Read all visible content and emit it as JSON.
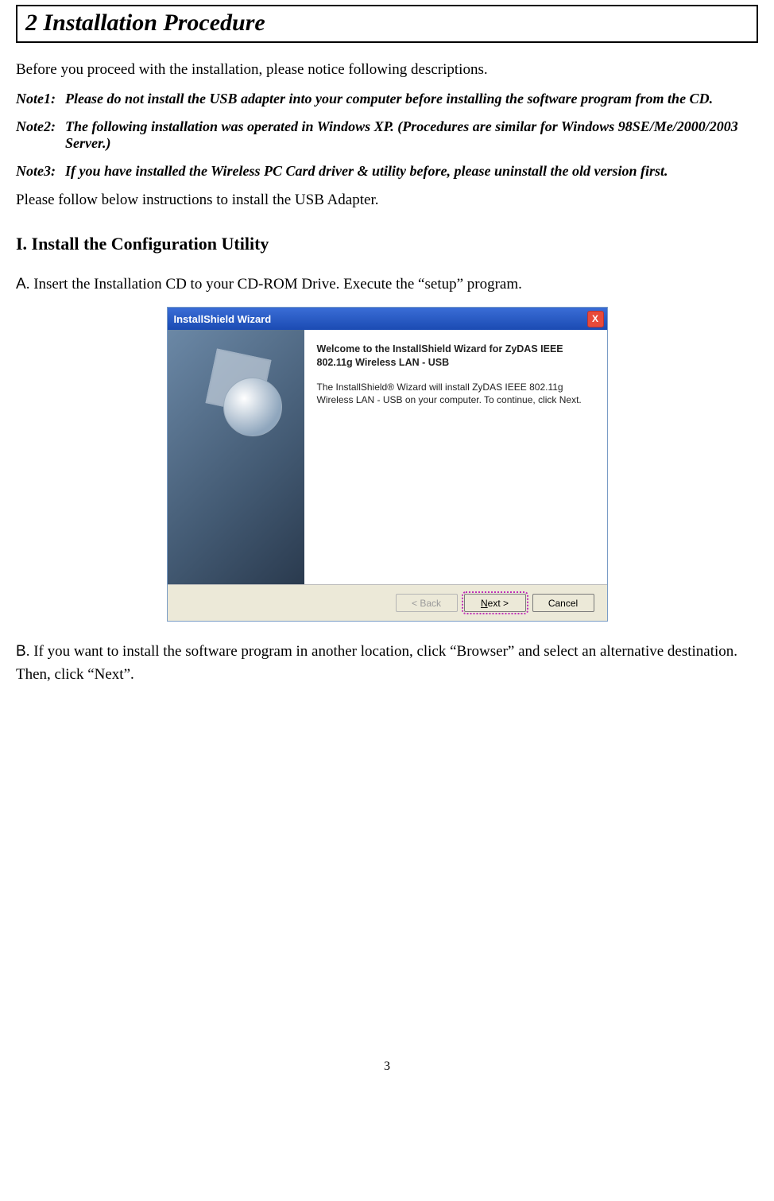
{
  "chapter": {
    "title": "2  Installation Procedure"
  },
  "intro": "Before you proceed with the installation, please notice following descriptions.",
  "notes": [
    {
      "label": "Note1:",
      "body": "Please do not install the USB adapter into your computer before installing the software program from the CD."
    },
    {
      "label": "Note2:",
      "body": "The following installation was operated in Windows XP.  (Procedures are similar for Windows 98SE/Me/2000/2003 Server.)"
    },
    {
      "label": "Note3:",
      "body": "If you have installed the Wireless PC Card driver & utility before, please uninstall the old version first."
    }
  ],
  "follow": "Please follow below instructions to install the USB Adapter.",
  "section_h": "I. Install the Configuration Utility",
  "steps": {
    "A": {
      "letter": "A",
      "body": ". Insert the Installation CD to your CD-ROM Drive. Execute the “setup” program."
    },
    "B": {
      "letter": "B",
      "body": ". If you want to install the software program in another location, click “Browser” and select an alternative destination. Then, click “Next”."
    }
  },
  "wizard": {
    "title": "InstallShield Wizard",
    "close": "X",
    "heading": "Welcome to the InstallShield Wizard for ZyDAS IEEE 802.11g Wireless LAN - USB",
    "text": "The InstallShield® Wizard will install ZyDAS IEEE 802.11g Wireless LAN - USB on your computer.  To continue, click Next.",
    "buttons": {
      "back_label": "< Back",
      "next_label_pre": "",
      "next_letter": "N",
      "next_label_post": "ext >",
      "cancel_label": "Cancel"
    }
  },
  "page_number": "3"
}
